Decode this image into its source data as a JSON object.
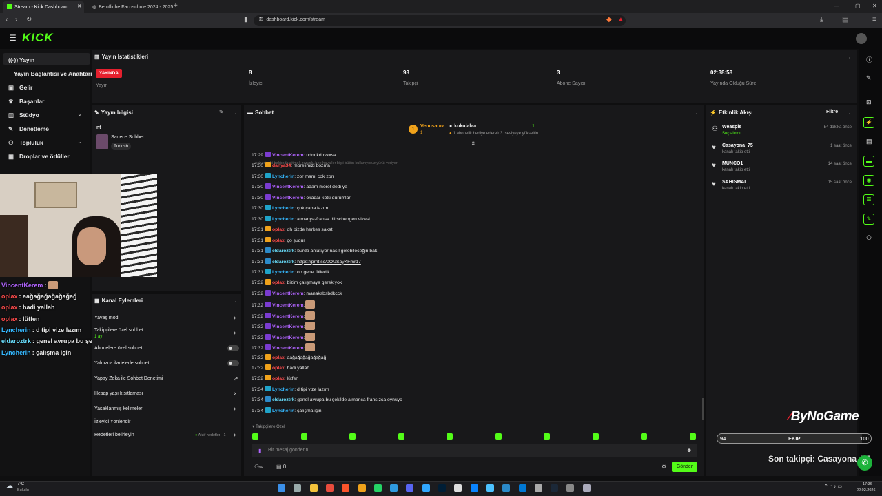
{
  "browser": {
    "tabs": [
      {
        "label": "Stream - Kick Dashboard",
        "active": true
      },
      {
        "label": "Berufliche Fachschule 2024 - 2025",
        "active": false
      }
    ],
    "url": "dashboard.kick.com/stream"
  },
  "brand": {
    "logo": "KICK",
    "accent": "#53fc18"
  },
  "sidebar": {
    "items": [
      {
        "label": "Yayın",
        "icon": "broadcast-icon"
      },
      {
        "label": "Yayın Bağlantısı ve Anahtarı",
        "icon": ""
      },
      {
        "label": "Gelir",
        "icon": "dollar-icon"
      },
      {
        "label": "Başarılar",
        "icon": "trophy-icon"
      },
      {
        "label": "Stüdyo",
        "icon": "studio-icon"
      },
      {
        "label": "Denetleme",
        "icon": "wrench-icon"
      },
      {
        "label": "Topluluk",
        "icon": "users-icon"
      },
      {
        "label": "Droplar ve ödüller",
        "icon": "gift-icon"
      }
    ]
  },
  "stats": {
    "title": "Yayın İstatistikleri",
    "live_badge": "YAYINDA",
    "live_label": "Yayın",
    "items": [
      {
        "value": "8",
        "label": "İzleyici"
      },
      {
        "value": "93",
        "label": "Takipçi"
      },
      {
        "value": "3",
        "label": "Abone Sayısı"
      },
      {
        "value": "02:38:58",
        "label": "Yayında Olduğu Süre"
      }
    ]
  },
  "stream_info": {
    "title": "Yayın bilgisi",
    "stream_title": "nt",
    "category": "Sadece Sohbet",
    "tag": "Turkish"
  },
  "overlay_chat": [
    {
      "user": "VincentKerem",
      "text": ":",
      "color": "#b164ff",
      "emote": true
    },
    {
      "user": "oplax",
      "text": ": aağağağağağağağ",
      "color": "#ff4b4b"
    },
    {
      "user": "oplax",
      "text": ": hadi yallah",
      "color": "#ff4b4b"
    },
    {
      "user": "oplax",
      "text": ": lütfen",
      "color": "#ff4b4b"
    },
    {
      "user": "Lyncherin",
      "text": ": d tipi vize lazım",
      "color": "#35b8ff"
    },
    {
      "user": "eldaroztrk",
      "text": ": genel avrupa bu şekilde almanca fransızca oynuyo",
      "color": "#6ae0ff"
    },
    {
      "user": "Lyncherin",
      "text": ": çalışma için",
      "color": "#35b8ff"
    }
  ],
  "channel_actions": {
    "title": "Kanal Eylemleri",
    "items": [
      {
        "label": "Yavaş mod",
        "control": "arrow"
      },
      {
        "label": "Takipçilere özel sohbet",
        "sub": "1 ay",
        "control": "arrow"
      },
      {
        "label": "Abonelere özel sohbet",
        "control": "toggle"
      },
      {
        "label": "Yalnızca ifadelerle sohbet",
        "control": "toggle"
      },
      {
        "label": "Yapay Zeka ile Sohbet Denetimi",
        "control": "external"
      },
      {
        "label": "Hesap yaşı kısıtlaması",
        "control": "arrow"
      },
      {
        "label": "Yasaklanmış kelimeler",
        "control": "arrow"
      },
      {
        "label": "İzleyici Yönlendir",
        "control": "none"
      },
      {
        "label": "Hedefleri belirleyin",
        "control": "arrow",
        "extra": "Aktif hedefler · 1"
      }
    ]
  },
  "chat": {
    "title": "Sohbet",
    "pinned": {
      "gifter": "Venusaura",
      "gifter_count": "1",
      "recipient": "kukulalaa",
      "recipient_count": "1",
      "text": "1 abonelik hediye ederek 3. seviyeye yükseltin"
    },
    "system_notes": [
      "Lyncherin: bi baktında gitmek zorunlu bee hayaller biçti bütün kullanıyoruz yürüt veriyor"
    ],
    "messages": [
      {
        "time": "17:29",
        "user": "VincentKerem",
        "color": "purple",
        "text": ": ndndkdnvkxsa"
      },
      {
        "time": "17:30",
        "user": "danya34",
        "color": "red",
        "text": ": morelimizi bozma"
      },
      {
        "time": "17:30",
        "user": "Lyncherin",
        "color": "cyan",
        "text": ": zor mami cok zorr"
      },
      {
        "time": "17:30",
        "user": "VincentKerem",
        "color": "purple",
        "text": ": adam morel dedi ya"
      },
      {
        "time": "17:30",
        "user": "VincentKerem",
        "color": "purple",
        "text": ": okadar kötü durumlar"
      },
      {
        "time": "17:30",
        "user": "Lyncherin",
        "color": "cyan",
        "text": ": çok çaba lazım"
      },
      {
        "time": "17:30",
        "user": "Lyncherin",
        "color": "cyan",
        "text": ": almanya-fransa dil schengen vizesi"
      },
      {
        "time": "17:31",
        "user": "oplax",
        "color": "red",
        "text": ": oh bizde herkes sakat"
      },
      {
        "time": "17:31",
        "user": "oplax",
        "color": "red",
        "text": ": ço şuqur"
      },
      {
        "time": "17:31",
        "user": "eldaroztrk",
        "color": "teal",
        "text": ": burda anlatıyor nasıl gelebileceğin bak"
      },
      {
        "time": "17:31",
        "user": "eldaroztrk",
        "color": "teal",
        "text": ": https://prnt.sc/0OUSayKFmr17"
      },
      {
        "time": "17:31",
        "user": "Lyncherin",
        "color": "cyan",
        "text": ": oo gene fülledik"
      },
      {
        "time": "17:32",
        "user": "oplax",
        "color": "red",
        "text": ": bizim çalışmaya gerek yok"
      },
      {
        "time": "17:32",
        "user": "VincentKerem",
        "color": "purple",
        "text": ": manaksbsbdkcck"
      },
      {
        "time": "17:32",
        "user": "VincentKerem",
        "color": "purple",
        "text": ":",
        "emote": true
      },
      {
        "time": "17:32",
        "user": "VincentKerem",
        "color": "purple",
        "text": ":",
        "emote": true
      },
      {
        "time": "17:32",
        "user": "VincentKerem",
        "color": "purple",
        "text": ":",
        "emote": true
      },
      {
        "time": "17:32",
        "user": "VincentKerem",
        "color": "purple",
        "text": ":",
        "emote": true
      },
      {
        "time": "17:32",
        "user": "VincentKerem",
        "color": "purple",
        "text": ":",
        "emote": true
      },
      {
        "time": "17:32",
        "user": "oplax",
        "color": "red",
        "text": ": aağağağağağağağ"
      },
      {
        "time": "17:32",
        "user": "oplax",
        "color": "red",
        "text": ": hadi yallah"
      },
      {
        "time": "17:32",
        "user": "oplax",
        "color": "red",
        "text": ": lütfen"
      },
      {
        "time": "17:34",
        "user": "Lyncherin",
        "color": "cyan",
        "text": ": d tipi vize lazım"
      },
      {
        "time": "17:34",
        "user": "eldaroztrk",
        "color": "teal",
        "text": ": genel avrupa bu şekilde almanca fransızca oynuyo"
      },
      {
        "time": "17:34",
        "user": "Lyncherin",
        "color": "cyan",
        "text": ": çalışma için"
      }
    ],
    "follower_only": "Takipçilere Özel",
    "input_placeholder": "Bir mesaj gönderin",
    "send_label": "Gönder",
    "viewer_count": "0"
  },
  "activity": {
    "title": "Etkinlik Akışı",
    "filter_label": "Filtre",
    "items": [
      {
        "name": "Weaspie",
        "sub": "Suç alındı",
        "time": "54 dakika önce",
        "icon": "users-icon"
      },
      {
        "name": "Casayona_75",
        "sub": "kanalı takip etti",
        "time": "1 saat önce",
        "icon": "heart-icon"
      },
      {
        "name": "MUNCO1",
        "sub": "kanalı takip etti",
        "time": "14 saat önce",
        "icon": "heart-icon"
      },
      {
        "name": "SAHISMAL",
        "sub": "kanalı takip etti",
        "time": "15 saat önce",
        "icon": "heart-icon"
      }
    ]
  },
  "overlay": {
    "watermark": "ByNoGame",
    "goal_left": "94",
    "goal_label": "EKIP",
    "goal_right": "100",
    "goal_fraction": 0.94,
    "last_follower": "Son takipçi: Casayona_75"
  },
  "taskbar": {
    "weather_temp": "7°C",
    "weather_desc": "Bulutlu",
    "time": "17:36",
    "date": "22.02.2026"
  }
}
